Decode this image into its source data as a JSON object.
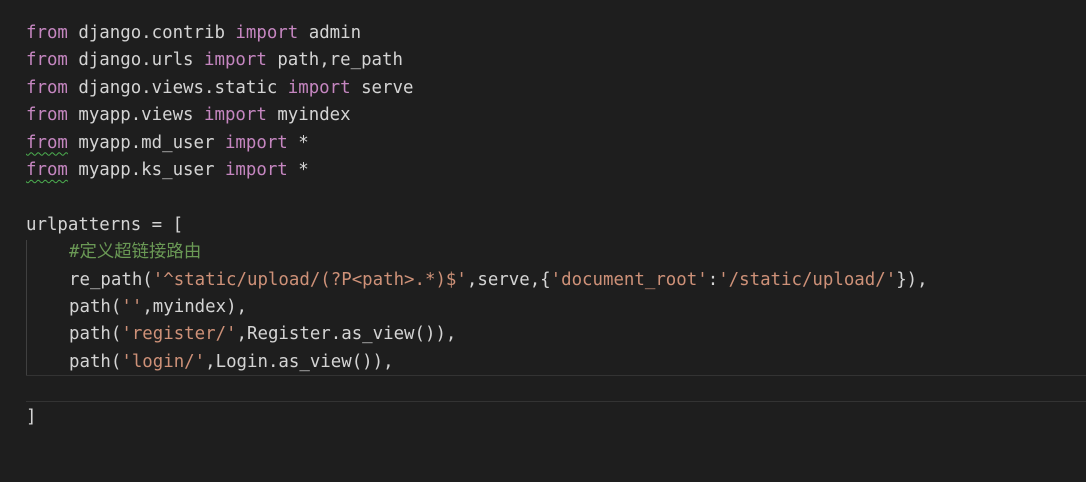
{
  "code": {
    "top_partial": "\"\"\"",
    "lines": [
      {
        "kw1": "from",
        "mod": " django.contrib ",
        "kw2": "import",
        "name": " admin"
      },
      {
        "kw1": "from",
        "mod": " django.urls ",
        "kw2": "import",
        "name": " path,re_path"
      },
      {
        "kw1": "from",
        "mod": " django.views.static ",
        "kw2": "import",
        "name": " serve"
      },
      {
        "kw1": "from",
        "mod": " myapp.views ",
        "kw2": "import",
        "name": " myindex"
      },
      {
        "kw1": "from",
        "mod": " myapp.md_user ",
        "kw2": "import",
        "name": " *"
      },
      {
        "kw1": "from",
        "mod": " myapp.ks_user ",
        "kw2": "import",
        "name": " *"
      }
    ],
    "urlpatterns": "urlpatterns = [",
    "comment": "#定义超链接路由",
    "re_path": {
      "fn": "re_path(",
      "pattern": "'^static/upload/(?P<path>.*)$'",
      "mid": ",serve,{",
      "key": "'document_root'",
      "colon": ":",
      "value": "'/static/upload/'",
      "end": "}),"
    },
    "path1": {
      "fn": "path(",
      "arg": "''",
      "rest": ",myindex),"
    },
    "path2": {
      "fn": "path(",
      "arg": "'register/'",
      "rest": ",Register.as_view()),"
    },
    "path3": {
      "fn": "path(",
      "arg": "'login/'",
      "rest": ",Login.as_view()),"
    },
    "close": "]"
  },
  "colors": {
    "background": "#1e1e1e",
    "keyword": "#c586c0",
    "string": "#ce9178",
    "comment": "#6a9955",
    "text": "#d4d4d4",
    "squiggle": "#4caf50"
  }
}
